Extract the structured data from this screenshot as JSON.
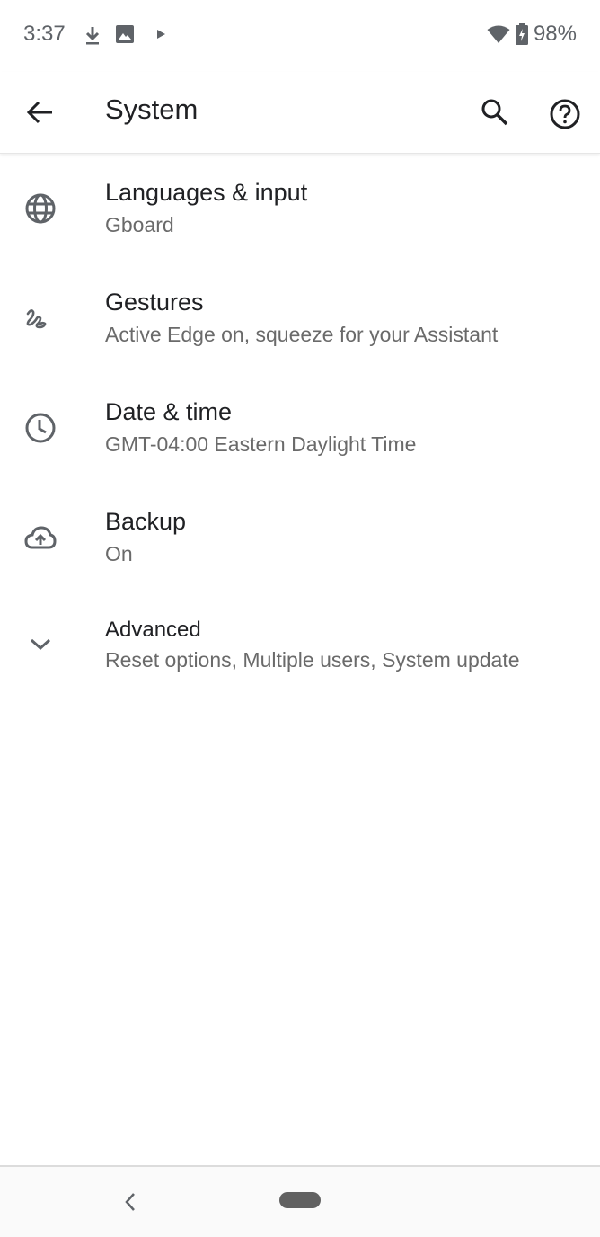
{
  "status_bar": {
    "time": "3:37",
    "left_icons": [
      "download-icon",
      "image-icon",
      "play-store-icon"
    ],
    "right_icons": [
      "wifi-icon",
      "battery-charging-icon"
    ],
    "battery_percent": "98%"
  },
  "app_bar": {
    "title": "System",
    "back_icon": "arrow-back-icon",
    "actions": [
      "search-icon",
      "help-icon"
    ]
  },
  "items": [
    {
      "icon": "globe-icon",
      "title": "Languages & input",
      "summary": "Gboard"
    },
    {
      "icon": "gesture-icon",
      "title": "Gestures",
      "summary": "Active Edge on, squeeze for your Assistant"
    },
    {
      "icon": "clock-icon",
      "title": "Date & time",
      "summary": "GMT-04:00 Eastern Daylight Time"
    },
    {
      "icon": "cloud-upload-icon",
      "title": "Backup",
      "summary": "On"
    },
    {
      "icon": "chevron-down-icon",
      "title": "Advanced",
      "summary": "Reset options, Multiple users, System update"
    }
  ],
  "nav_bar": {
    "buttons": [
      "nav-back-icon",
      "home-pill"
    ]
  },
  "colors": {
    "icon_gray": "#5f6368",
    "text_primary": "#202124",
    "text_secondary": "#6a6a6a"
  }
}
